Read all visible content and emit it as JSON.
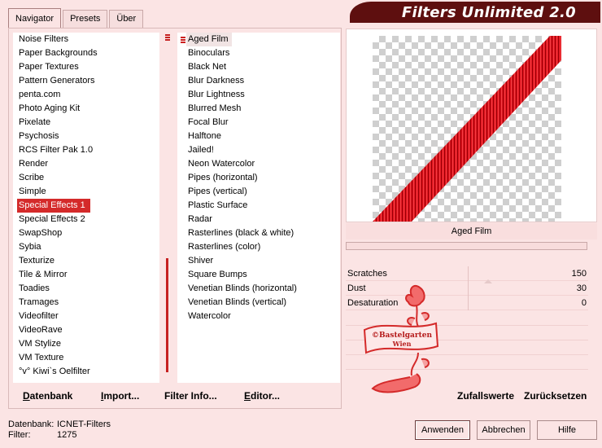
{
  "app": {
    "title": "Filters Unlimited 2.0"
  },
  "tabs": [
    {
      "label": "Navigator",
      "active": true
    },
    {
      "label": "Presets",
      "active": false
    },
    {
      "label": "Über",
      "active": false
    }
  ],
  "categories": [
    "Noise Filters",
    "Paper Backgrounds",
    "Paper Textures",
    "Pattern Generators",
    "penta.com",
    "Photo Aging Kit",
    "Pixelate",
    "Psychosis",
    "RCS Filter Pak 1.0",
    "Render",
    "Scribe",
    "Simple",
    "Special Effects 1",
    "Special Effects 2",
    "SwapShop",
    "Sybia",
    "Texturize",
    "Tile & Mirror",
    "Toadies",
    "Tramages",
    "Videofilter",
    "VideoRave",
    "VM Stylize",
    "VM Texture",
    "°v° Kiwi`s Oelfilter"
  ],
  "selected_category": "Special Effects 1",
  "filters": [
    "Aged Film",
    "Binoculars",
    "Black Net",
    "Blur Darkness",
    "Blur Lightness",
    "Blurred Mesh",
    "Focal Blur",
    "Halftone",
    "Jailed!",
    "Neon Watercolor",
    "Pipes (horizontal)",
    "Pipes (vertical)",
    "Plastic Surface",
    "Radar",
    "Rasterlines (black & white)",
    "Rasterlines (color)",
    "Shiver",
    "Square Bumps",
    "Venetian Blinds (horizontal)",
    "Venetian Blinds (vertical)",
    "Watercolor"
  ],
  "selected_filter": "Aged Film",
  "left_buttons": {
    "database": {
      "prefix": "",
      "underline": "D",
      "rest": "atenbank"
    },
    "import": {
      "underline": "I",
      "rest": "mport..."
    },
    "filter_info": {
      "underline": "",
      "rest": "Filter Info..."
    },
    "editor": {
      "underline": "E",
      "rest": "ditor..."
    }
  },
  "preview": {
    "filter_name": "Aged Film",
    "accent_color": "#e0101a"
  },
  "sliders": [
    {
      "label": "Scratches",
      "value": "150"
    },
    {
      "label": "Dust",
      "value": "30"
    },
    {
      "label": "Desaturation",
      "value": "0"
    }
  ],
  "right_buttons": {
    "random": "Zufallswerte",
    "reset": "Zurücksetzen"
  },
  "status": {
    "database_label": "Datenbank:",
    "database_value": "ICNET-Filters",
    "filter_label": "Filter:",
    "filter_value": "1275"
  },
  "dialog_buttons": {
    "apply": "Anwenden",
    "cancel": "Abbrechen",
    "help": "Hilfe"
  },
  "watermark": {
    "text_line1": "©Bastelgarten",
    "text_line2": "Wien"
  },
  "colors": {
    "background": "#fbe4e4",
    "selection": "#d42a2a",
    "banner": "#5e0f0f"
  }
}
